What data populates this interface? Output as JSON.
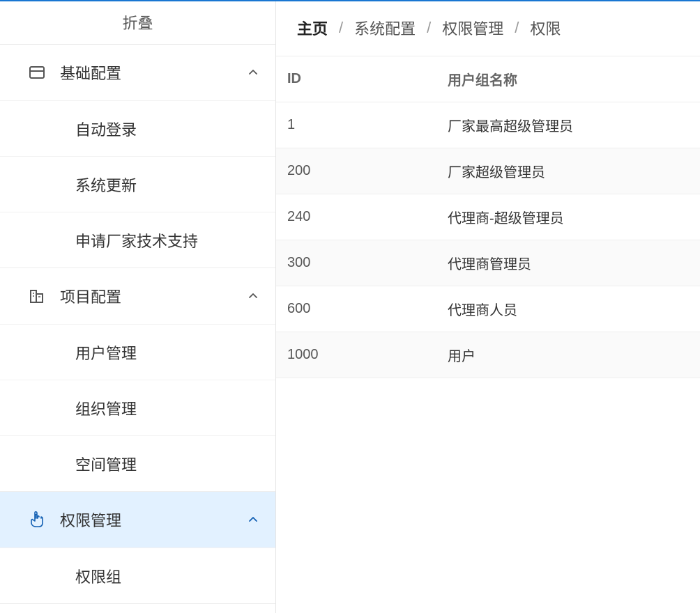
{
  "sidebar": {
    "collapse_label": "折叠",
    "sections": [
      {
        "label": "基础配置",
        "active": false,
        "icon": "card-icon",
        "items": [
          {
            "label": "自动登录"
          },
          {
            "label": "系统更新"
          },
          {
            "label": "申请厂家技术支持"
          }
        ]
      },
      {
        "label": "项目配置",
        "active": false,
        "icon": "building-icon",
        "items": [
          {
            "label": "用户管理"
          },
          {
            "label": "组织管理"
          },
          {
            "label": "空间管理"
          }
        ]
      },
      {
        "label": "权限管理",
        "active": true,
        "icon": "pointer-icon",
        "items": [
          {
            "label": "权限组"
          }
        ]
      }
    ]
  },
  "breadcrumb": {
    "items": [
      {
        "label": "主页",
        "home": true
      },
      {
        "label": "系统配置"
      },
      {
        "label": "权限管理"
      },
      {
        "label": "权限"
      }
    ]
  },
  "table": {
    "headers": {
      "id": "ID",
      "name": "用户组名称"
    },
    "rows": [
      {
        "id": "1",
        "name": "厂家最高超级管理员"
      },
      {
        "id": "200",
        "name": "厂家超级管理员"
      },
      {
        "id": "240",
        "name": "代理商-超级管理员"
      },
      {
        "id": "300",
        "name": "代理商管理员"
      },
      {
        "id": "600",
        "name": "代理商人员"
      },
      {
        "id": "1000",
        "name": "用户"
      }
    ]
  }
}
